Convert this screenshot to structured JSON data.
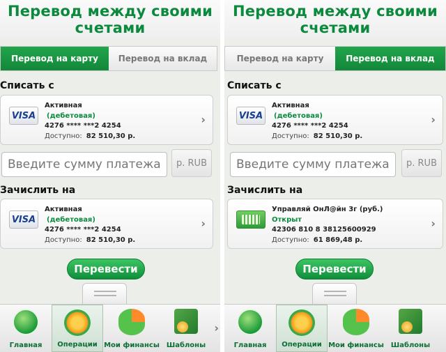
{
  "screens": [
    {
      "title_line1": "Перевод между своими",
      "title_line2": "счетами",
      "tabs": [
        {
          "label": "Перевод на карту",
          "active": true
        },
        {
          "label": "Перевод на вклад",
          "active": false
        }
      ],
      "from_label": "Списать с",
      "from_card": {
        "name": "Активная",
        "type": "(дебетовая)",
        "number": "4276 **** ***2 4254",
        "available_label": "Доступно:",
        "available_value": "82 510,30 р.",
        "logo": "VISA"
      },
      "amount_placeholder": "Введите сумму платежа",
      "currency": "р. RUB",
      "to_label": "Зачислить на",
      "to_card": {
        "name": "Активная",
        "type": "(дебетовая)",
        "number": "4276 **** ***2 4254",
        "available_label": "Доступно:",
        "available_value": "82 510,30 р.",
        "logo": "VISA"
      },
      "send_button": "Перевести",
      "nav": [
        "Главная",
        "Операции",
        "Мои финансы",
        "Шаблоны"
      ]
    },
    {
      "title_line1": "Перевод между своими",
      "title_line2": "счетами",
      "tabs": [
        {
          "label": "Перевод на карту",
          "active": false
        },
        {
          "label": "Перевод на вклад",
          "active": true
        }
      ],
      "from_label": "Списать с",
      "from_card": {
        "name": "Активная",
        "type": "(дебетовая)",
        "number": "4276 **** ***2 4254",
        "available_label": "Доступно:",
        "available_value": "82 510,30 р.",
        "logo": "VISA"
      },
      "amount_placeholder": "Введите сумму платежа",
      "currency": "р. RUB",
      "to_label": "Зачислить на",
      "to_card": {
        "name": "Управляй ОнЛ@йн 3г (руб.)",
        "type": "Открыт",
        "number": "42306 810 8 38125600929",
        "available_label": "Доступно:",
        "available_value": "61 869,48 р."
      },
      "send_button": "Перевести",
      "nav": [
        "Главная",
        "Операции",
        "Мои финансы",
        "Шаблоны"
      ]
    }
  ],
  "colors": {
    "brand_green": "#0b8a3e",
    "tab_active": "#12873a"
  },
  "icons": [
    "visa-logo",
    "sberbank-account-icon",
    "chevron-right-icon",
    "home-icon",
    "operations-icon",
    "finances-icon",
    "templates-icon"
  ]
}
